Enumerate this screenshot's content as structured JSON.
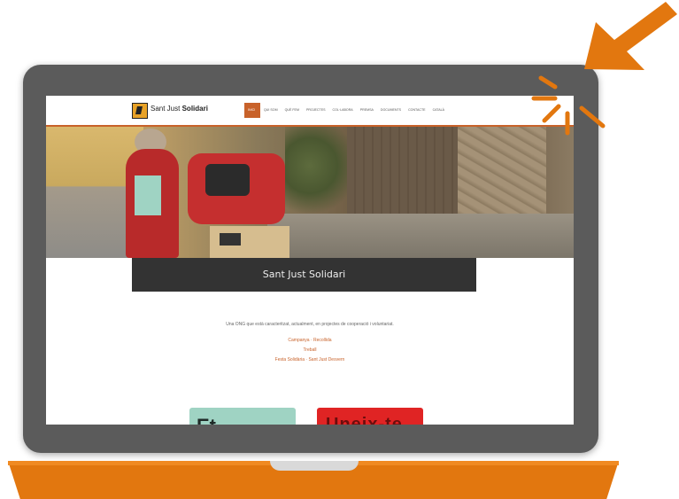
{
  "website": {
    "logo_text_light": "Sant Just",
    "logo_text_bold": "Solidari",
    "nav": [
      "INICI",
      "QUI SOM",
      "QUÈ FEM",
      "PROJECTES",
      "COL·LABORA",
      "PREMSA",
      "DOCUMENTS",
      "CONTACTE",
      "CATALÀ"
    ],
    "hero_title": "Sant Just Solidari",
    "intro_text": "Una ONG que està caracteritzat, actualment, en projectes de cooperació i voluntariat.",
    "links": [
      "Campanya · Recollida",
      "Treball",
      "Festa Solidària · Sant Just Desvern"
    ],
    "card_left_text": "Et",
    "card_right_text": "Uneix-te"
  },
  "colors": {
    "accent": "#e2770f",
    "frame": "#5b5b5b",
    "nav_active": "#c8622a",
    "title_bar": "#333333"
  },
  "icons": {
    "click_indicator": "click-burst-icon",
    "pointer": "arrow-pointer-icon"
  }
}
